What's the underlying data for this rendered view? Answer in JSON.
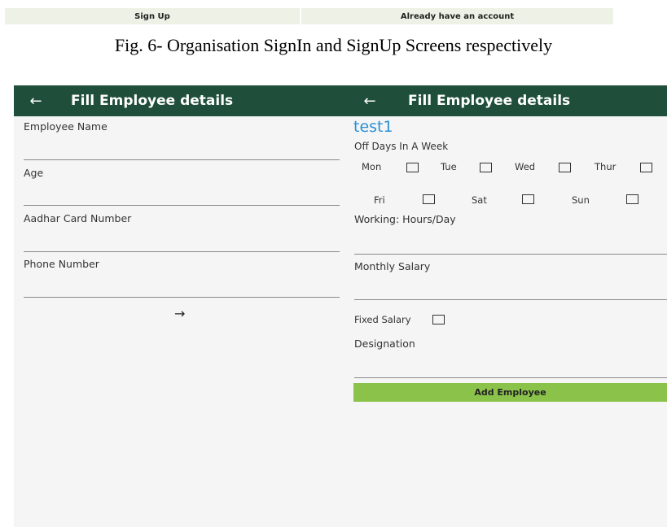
{
  "top_strip": {
    "left_label": "Sign Up",
    "right_label": "Already have an account"
  },
  "caption": "Fig. 6- Organisation SignIn and SignUp Screens respectively",
  "left_screen": {
    "title": "Fill Employee details",
    "fields": [
      "Employee Name",
      "Age",
      "Aadhar Card Number",
      "Phone Number"
    ],
    "next_arrow": "→"
  },
  "right_screen": {
    "title": "Fill Employee details",
    "employee_name": "test1",
    "off_days_label": "Off Days In A Week",
    "days": [
      "Mon",
      "Tue",
      "Wed",
      "Thur",
      "Fri",
      "Sat",
      "Sun"
    ],
    "working_hours_label": "Working: Hours/Day",
    "monthly_salary_label": "Monthly Salary",
    "fixed_salary_label": "Fixed Salary",
    "designation_label": "Designation",
    "add_button": "Add Employee"
  },
  "icons": {
    "back": "arrow-left-icon",
    "next": "arrow-right-icon"
  },
  "colors": {
    "appbar": "#1f4f3a",
    "name_text": "#2a8fd6",
    "button": "#8bc34a",
    "screen_bg": "#f5f5f5"
  }
}
